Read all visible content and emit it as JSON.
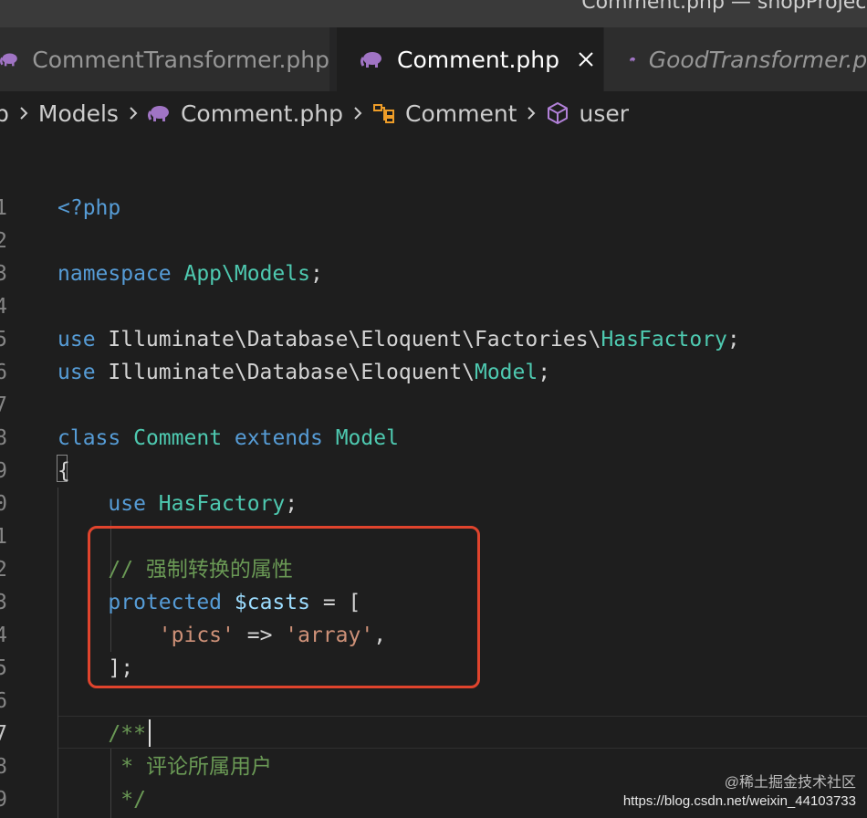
{
  "window": {
    "title": "Comment.php — shopProject"
  },
  "tabs": [
    {
      "label": "CommentTransformer.php",
      "icon": "php-elephant-icon",
      "active": false
    },
    {
      "label": "Comment.php",
      "icon": "php-elephant-icon",
      "active": true,
      "close_glyph": "×"
    },
    {
      "label": "GoodTransformer.php",
      "icon": "php-elephant-icon",
      "active": false
    }
  ],
  "breadcrumb": {
    "lead": "p",
    "items": [
      {
        "label": "Models",
        "icon": ""
      },
      {
        "label": "Comment.php",
        "icon": "php-elephant-icon"
      },
      {
        "label": "Comment",
        "icon": "class-icon"
      },
      {
        "label": "user",
        "icon": "method-cube-icon"
      }
    ]
  },
  "editor": {
    "line_numbers": [
      "1",
      "2",
      "3",
      "4",
      "5",
      "6",
      "7",
      "8",
      "9",
      "0",
      "1",
      "2",
      "3",
      "4",
      "5",
      "6",
      "7",
      "8",
      "9"
    ],
    "active_line_index": 16,
    "lines": [
      [
        {
          "t": "kw",
          "v": "<?php"
        }
      ],
      [],
      [
        {
          "t": "kw",
          "v": "namespace"
        },
        {
          "t": "tx",
          "v": " "
        },
        {
          "t": "ty",
          "v": "App\\Models"
        },
        {
          "t": "tx",
          "v": ";"
        }
      ],
      [],
      [
        {
          "t": "kw",
          "v": "use"
        },
        {
          "t": "tx",
          "v": " Illuminate\\Database\\Eloquent\\Factories\\"
        },
        {
          "t": "ty",
          "v": "HasFactory"
        },
        {
          "t": "tx",
          "v": ";"
        }
      ],
      [
        {
          "t": "kw",
          "v": "use"
        },
        {
          "t": "tx",
          "v": " Illuminate\\Database\\Eloquent\\"
        },
        {
          "t": "ty",
          "v": "Model"
        },
        {
          "t": "tx",
          "v": ";"
        }
      ],
      [],
      [
        {
          "t": "kw",
          "v": "class"
        },
        {
          "t": "tx",
          "v": " "
        },
        {
          "t": "ty",
          "v": "Comment"
        },
        {
          "t": "tx",
          "v": " "
        },
        {
          "t": "kw",
          "v": "extends"
        },
        {
          "t": "tx",
          "v": " "
        },
        {
          "t": "ty",
          "v": "Model"
        }
      ],
      [
        {
          "t": "tx",
          "v": "{"
        }
      ],
      [
        {
          "t": "tx",
          "v": "    "
        },
        {
          "t": "kw",
          "v": "use"
        },
        {
          "t": "tx",
          "v": " "
        },
        {
          "t": "ty",
          "v": "HasFactory"
        },
        {
          "t": "tx",
          "v": ";"
        }
      ],
      [],
      [
        {
          "t": "tx",
          "v": "    "
        },
        {
          "t": "cm",
          "v": "// 强制转换的属性"
        }
      ],
      [
        {
          "t": "tx",
          "v": "    "
        },
        {
          "t": "kw",
          "v": "protected"
        },
        {
          "t": "tx",
          "v": " "
        },
        {
          "t": "vr",
          "v": "$casts"
        },
        {
          "t": "tx",
          "v": " = ["
        }
      ],
      [
        {
          "t": "tx",
          "v": "        "
        },
        {
          "t": "st",
          "v": "'pics'"
        },
        {
          "t": "tx",
          "v": " => "
        },
        {
          "t": "st",
          "v": "'array'"
        },
        {
          "t": "tx",
          "v": ","
        }
      ],
      [
        {
          "t": "tx",
          "v": "    ];"
        }
      ],
      [],
      [
        {
          "t": "tx",
          "v": "    "
        },
        {
          "t": "cm",
          "v": "/**"
        }
      ],
      [
        {
          "t": "tx",
          "v": "     "
        },
        {
          "t": "cm",
          "v": "* 评论所属用户"
        }
      ],
      [
        {
          "t": "tx",
          "v": "     "
        },
        {
          "t": "cm",
          "v": "*/"
        }
      ]
    ]
  },
  "watermark": {
    "line1": "@稀土掘金技术社区",
    "line2": "https://blog.csdn.net/weixin_44103733"
  },
  "colors": {
    "keyword": "#569cd6",
    "type": "#4ec9b0",
    "variable": "#9cdcfe",
    "string": "#ce9178",
    "comment": "#6a9955",
    "annotation_box": "#e0442d"
  }
}
